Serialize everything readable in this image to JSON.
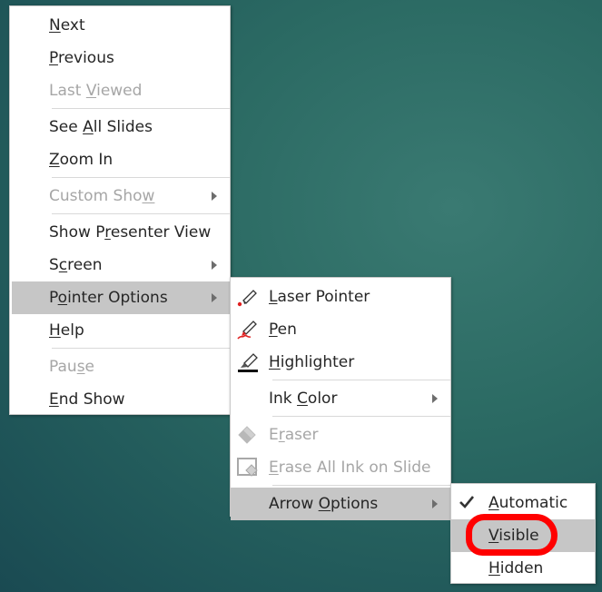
{
  "main_menu": {
    "items": [
      {
        "label": "Next",
        "accel": "N",
        "disabled": false
      },
      {
        "label": "Previous",
        "accel": "P",
        "disabled": false
      },
      {
        "label": "Last Viewed",
        "accel": "V",
        "disabled": true
      },
      {
        "label": "See All Slides",
        "accel": "A",
        "disabled": false
      },
      {
        "label": "Zoom In",
        "accel": "Z",
        "disabled": false
      },
      {
        "label": "Custom Show",
        "accel": "w",
        "disabled": true,
        "submenu": true
      },
      {
        "label": "Show Presenter View",
        "accel": "r",
        "disabled": false
      },
      {
        "label": "Screen",
        "accel": "c",
        "disabled": false,
        "submenu": true
      },
      {
        "label": "Pointer Options",
        "accel": "o",
        "disabled": false,
        "submenu": true,
        "highlighted": true
      },
      {
        "label": "Help",
        "accel": "H",
        "disabled": false
      },
      {
        "label": "Pause",
        "accel": "s",
        "disabled": true
      },
      {
        "label": "End Show",
        "accel": "E",
        "disabled": false
      }
    ]
  },
  "pointer_options_menu": {
    "items": [
      {
        "label": "Laser Pointer",
        "accel": "L",
        "icon": "laser-pointer-icon"
      },
      {
        "label": "Pen",
        "accel": "P",
        "icon": "pen-icon"
      },
      {
        "label": "Highlighter",
        "accel": "H",
        "icon": "highlighter-icon"
      },
      {
        "label": "Ink Color",
        "accel": "C",
        "submenu": true
      },
      {
        "label": "Eraser",
        "accel": "r",
        "icon": "eraser-icon",
        "disabled": true
      },
      {
        "label": "Erase All Ink on Slide",
        "accel": "E",
        "icon": "erase-all-icon",
        "disabled": true
      },
      {
        "label": "Arrow Options",
        "accel": "O",
        "submenu": true,
        "highlighted": true
      }
    ]
  },
  "arrow_options_menu": {
    "items": [
      {
        "label": "Automatic",
        "accel": "A",
        "checked": true
      },
      {
        "label": "Visible",
        "accel": "V",
        "highlighted": true,
        "annotated": true
      },
      {
        "label": "Hidden",
        "accel": "H"
      }
    ]
  },
  "colors": {
    "highlight": "#c6c6c6",
    "text": "#262626",
    "disabled_text": "#a6a6a6",
    "annotation": "#ff0000",
    "background": "#2b6a63"
  }
}
